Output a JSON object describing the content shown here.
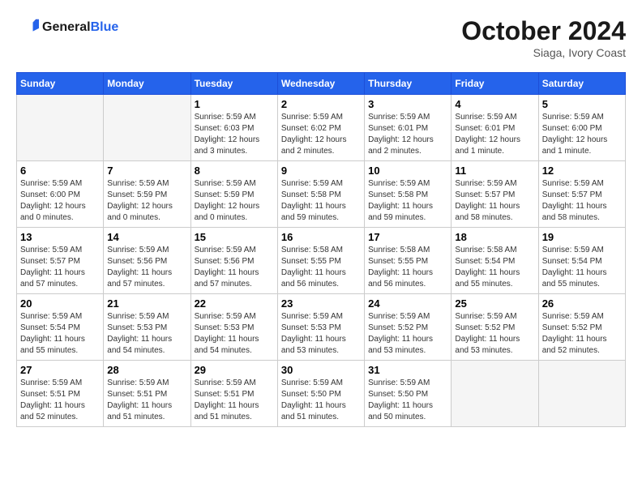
{
  "header": {
    "logo_line1": "General",
    "logo_line2": "Blue",
    "month": "October 2024",
    "location": "Siaga, Ivory Coast"
  },
  "days_of_week": [
    "Sunday",
    "Monday",
    "Tuesday",
    "Wednesday",
    "Thursday",
    "Friday",
    "Saturday"
  ],
  "weeks": [
    [
      {
        "day": "",
        "info": ""
      },
      {
        "day": "",
        "info": ""
      },
      {
        "day": "1",
        "info": "Sunrise: 5:59 AM\nSunset: 6:03 PM\nDaylight: 12 hours and 3 minutes."
      },
      {
        "day": "2",
        "info": "Sunrise: 5:59 AM\nSunset: 6:02 PM\nDaylight: 12 hours and 2 minutes."
      },
      {
        "day": "3",
        "info": "Sunrise: 5:59 AM\nSunset: 6:01 PM\nDaylight: 12 hours and 2 minutes."
      },
      {
        "day": "4",
        "info": "Sunrise: 5:59 AM\nSunset: 6:01 PM\nDaylight: 12 hours and 1 minute."
      },
      {
        "day": "5",
        "info": "Sunrise: 5:59 AM\nSunset: 6:00 PM\nDaylight: 12 hours and 1 minute."
      }
    ],
    [
      {
        "day": "6",
        "info": "Sunrise: 5:59 AM\nSunset: 6:00 PM\nDaylight: 12 hours and 0 minutes."
      },
      {
        "day": "7",
        "info": "Sunrise: 5:59 AM\nSunset: 5:59 PM\nDaylight: 12 hours and 0 minutes."
      },
      {
        "day": "8",
        "info": "Sunrise: 5:59 AM\nSunset: 5:59 PM\nDaylight: 12 hours and 0 minutes."
      },
      {
        "day": "9",
        "info": "Sunrise: 5:59 AM\nSunset: 5:58 PM\nDaylight: 11 hours and 59 minutes."
      },
      {
        "day": "10",
        "info": "Sunrise: 5:59 AM\nSunset: 5:58 PM\nDaylight: 11 hours and 59 minutes."
      },
      {
        "day": "11",
        "info": "Sunrise: 5:59 AM\nSunset: 5:57 PM\nDaylight: 11 hours and 58 minutes."
      },
      {
        "day": "12",
        "info": "Sunrise: 5:59 AM\nSunset: 5:57 PM\nDaylight: 11 hours and 58 minutes."
      }
    ],
    [
      {
        "day": "13",
        "info": "Sunrise: 5:59 AM\nSunset: 5:57 PM\nDaylight: 11 hours and 57 minutes."
      },
      {
        "day": "14",
        "info": "Sunrise: 5:59 AM\nSunset: 5:56 PM\nDaylight: 11 hours and 57 minutes."
      },
      {
        "day": "15",
        "info": "Sunrise: 5:59 AM\nSunset: 5:56 PM\nDaylight: 11 hours and 57 minutes."
      },
      {
        "day": "16",
        "info": "Sunrise: 5:58 AM\nSunset: 5:55 PM\nDaylight: 11 hours and 56 minutes."
      },
      {
        "day": "17",
        "info": "Sunrise: 5:58 AM\nSunset: 5:55 PM\nDaylight: 11 hours and 56 minutes."
      },
      {
        "day": "18",
        "info": "Sunrise: 5:58 AM\nSunset: 5:54 PM\nDaylight: 11 hours and 55 minutes."
      },
      {
        "day": "19",
        "info": "Sunrise: 5:59 AM\nSunset: 5:54 PM\nDaylight: 11 hours and 55 minutes."
      }
    ],
    [
      {
        "day": "20",
        "info": "Sunrise: 5:59 AM\nSunset: 5:54 PM\nDaylight: 11 hours and 55 minutes."
      },
      {
        "day": "21",
        "info": "Sunrise: 5:59 AM\nSunset: 5:53 PM\nDaylight: 11 hours and 54 minutes."
      },
      {
        "day": "22",
        "info": "Sunrise: 5:59 AM\nSunset: 5:53 PM\nDaylight: 11 hours and 54 minutes."
      },
      {
        "day": "23",
        "info": "Sunrise: 5:59 AM\nSunset: 5:53 PM\nDaylight: 11 hours and 53 minutes."
      },
      {
        "day": "24",
        "info": "Sunrise: 5:59 AM\nSunset: 5:52 PM\nDaylight: 11 hours and 53 minutes."
      },
      {
        "day": "25",
        "info": "Sunrise: 5:59 AM\nSunset: 5:52 PM\nDaylight: 11 hours and 53 minutes."
      },
      {
        "day": "26",
        "info": "Sunrise: 5:59 AM\nSunset: 5:52 PM\nDaylight: 11 hours and 52 minutes."
      }
    ],
    [
      {
        "day": "27",
        "info": "Sunrise: 5:59 AM\nSunset: 5:51 PM\nDaylight: 11 hours and 52 minutes."
      },
      {
        "day": "28",
        "info": "Sunrise: 5:59 AM\nSunset: 5:51 PM\nDaylight: 11 hours and 51 minutes."
      },
      {
        "day": "29",
        "info": "Sunrise: 5:59 AM\nSunset: 5:51 PM\nDaylight: 11 hours and 51 minutes."
      },
      {
        "day": "30",
        "info": "Sunrise: 5:59 AM\nSunset: 5:50 PM\nDaylight: 11 hours and 51 minutes."
      },
      {
        "day": "31",
        "info": "Sunrise: 5:59 AM\nSunset: 5:50 PM\nDaylight: 11 hours and 50 minutes."
      },
      {
        "day": "",
        "info": ""
      },
      {
        "day": "",
        "info": ""
      }
    ]
  ]
}
